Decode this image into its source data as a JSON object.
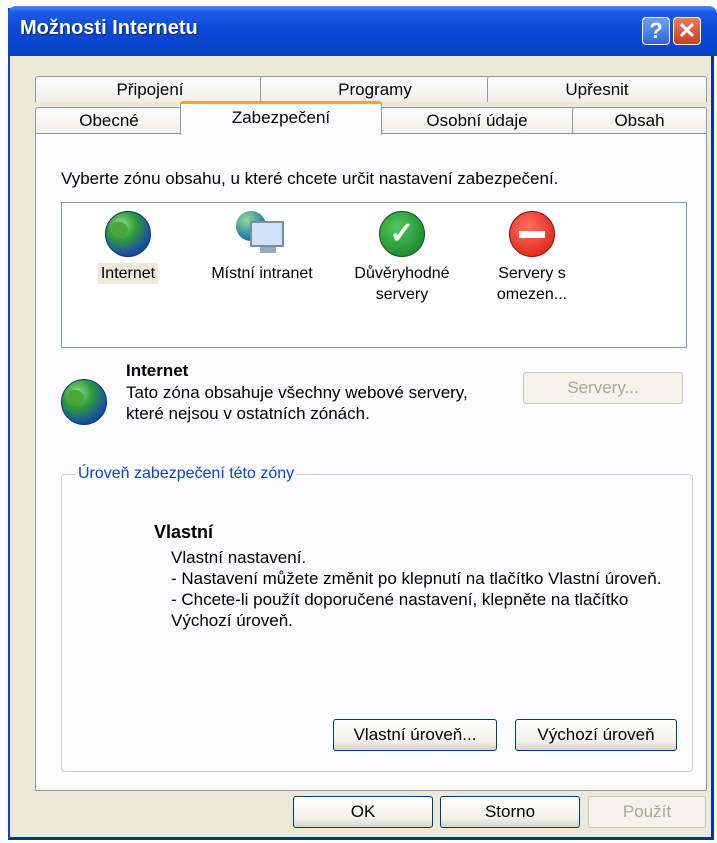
{
  "window": {
    "title": "Možnosti Internetu"
  },
  "titlebar": {
    "help_label": "?",
    "close_label": "✕"
  },
  "tabs": {
    "back": [
      "Připojení",
      "Programy",
      "Upřesnit"
    ],
    "front": [
      "Obecné",
      "Zabezpečení",
      "Osobní údaje",
      "Obsah"
    ],
    "active": "Zabezpečení"
  },
  "security": {
    "prompt": "Vyberte zónu obsahu, u které chcete určit nastavení zabezpečení.",
    "zones": [
      {
        "line1": "Internet",
        "line2": "",
        "icon": "globe-icon"
      },
      {
        "line1": "Místní intranet",
        "line2": "",
        "icon": "intranet-icon"
      },
      {
        "line1": "Důvěryhodné",
        "line2": "servery",
        "icon": "check-icon"
      },
      {
        "line1": "Servery s",
        "line2": "omezen...",
        "icon": "stop-icon"
      }
    ],
    "selected_zone": {
      "title": "Internet",
      "description": "Tato zóna obsahuje všechny webové servery, které nejsou v ostatních zónách."
    },
    "servers_button": "Servery...",
    "level_group_label": "Úroveň zabezpečení této zóny",
    "level": {
      "title": "Vlastní",
      "lines": [
        "Vlastní nastavení.",
        "- Nastavení můžete změnit po klepnutí na tlačítko Vlastní úroveň.",
        "- Chcete-li použít doporučené nastavení, klepněte na tlačítko Výchozí úroveň."
      ]
    },
    "custom_level_button": "Vlastní úroveň...",
    "default_level_button": "Výchozí úroveň"
  },
  "footer": {
    "ok": "OK",
    "cancel": "Storno",
    "apply": "Použít"
  },
  "colors": {
    "accent_tab": "#f9a61a",
    "titlebar": "#0a4ad6",
    "group_label": "#0046d5"
  }
}
